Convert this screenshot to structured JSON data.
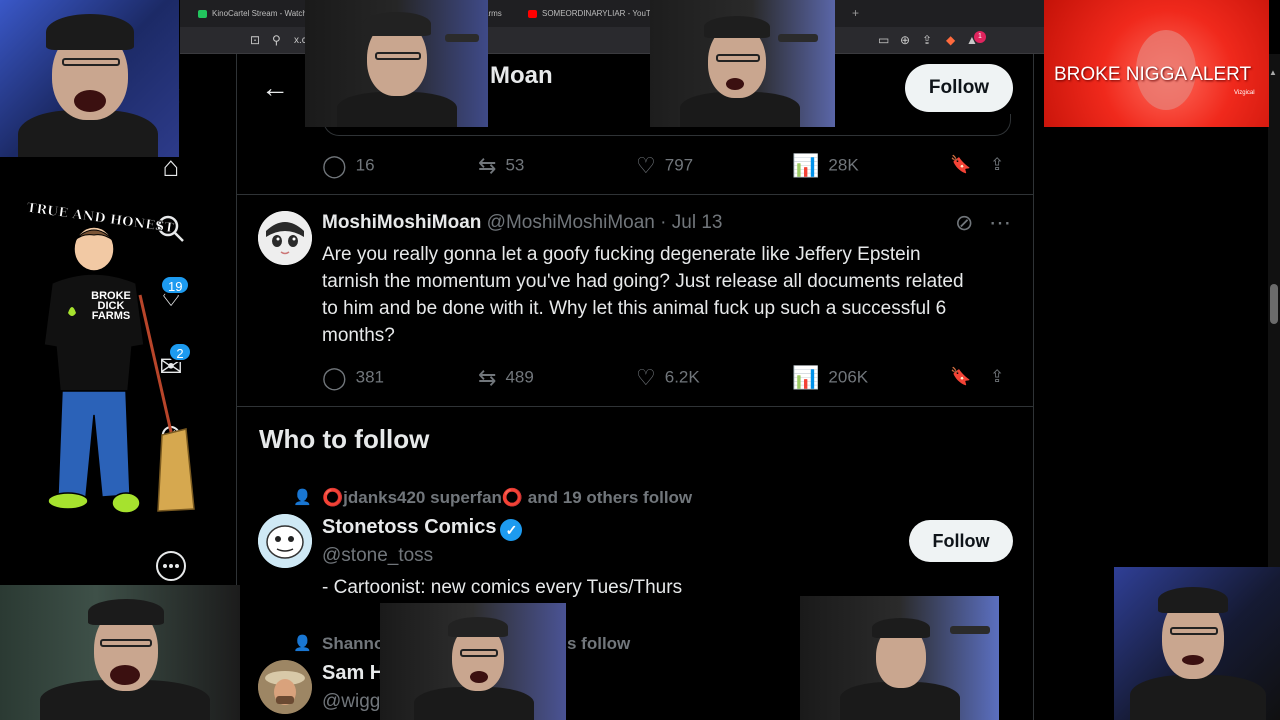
{
  "browser": {
    "tabs": [
      {
        "title": "KinoCartel Stream - Watch",
        "favicon_color": "#22c55e"
      },
      {
        "title": "arms",
        "favicon_color": ""
      },
      {
        "title": "SOMEORDINARYLIAR - YouTube",
        "favicon_color": "#ff0000"
      }
    ],
    "address_fragment": "x.c",
    "extension_badge": "1"
  },
  "header": {
    "title": "Moan",
    "follow_label": "Follow"
  },
  "prev_tweet_actions": {
    "replies": "16",
    "reposts": "53",
    "likes": "797",
    "views": "28K"
  },
  "tweet": {
    "display_name": "MoshiMoshiMoan",
    "handle": "@MoshiMoshiMoan",
    "date": "Jul 13",
    "text": "Are you really gonna let a goofy fucking degenerate like Jeffery Epstein tarnish the momentum you've had going?  Just release all documents related to him and be done with it.  Why let this animal fuck up such a successful 6 months?",
    "replies": "381",
    "reposts": "489",
    "likes": "6.2K",
    "views": "206K"
  },
  "nav": {
    "notifications_badge": "19",
    "messages_badge": "2"
  },
  "who_to_follow": {
    "title": "Who to follow",
    "suggestions": [
      {
        "social_context": "⭕jdanks420 superfan⭕ and 19 others follow",
        "name": "Stonetoss Comics",
        "handle": "@stone_toss",
        "bio": "- Cartoonist: new comics every Tues/Thurs",
        "follow_label": "Follow",
        "verified": true
      },
      {
        "social_context_start": "Shanno",
        "social_context_end": "s follow",
        "name": "Sam H",
        "handle": "@wigg"
      }
    ]
  },
  "overlays": {
    "alert_text": "BROKE NIGGA ALERT",
    "alert_watermark": "Vizgical",
    "cartoon_caption": "TRUE AND HONEST",
    "shirt_text": "BROKE DICK FARMS"
  },
  "colors": {
    "background": "#000000",
    "text": "#e7e9ea",
    "muted": "#71767b",
    "accent": "#1d9bf0",
    "follow_bg": "#eff3f4"
  }
}
